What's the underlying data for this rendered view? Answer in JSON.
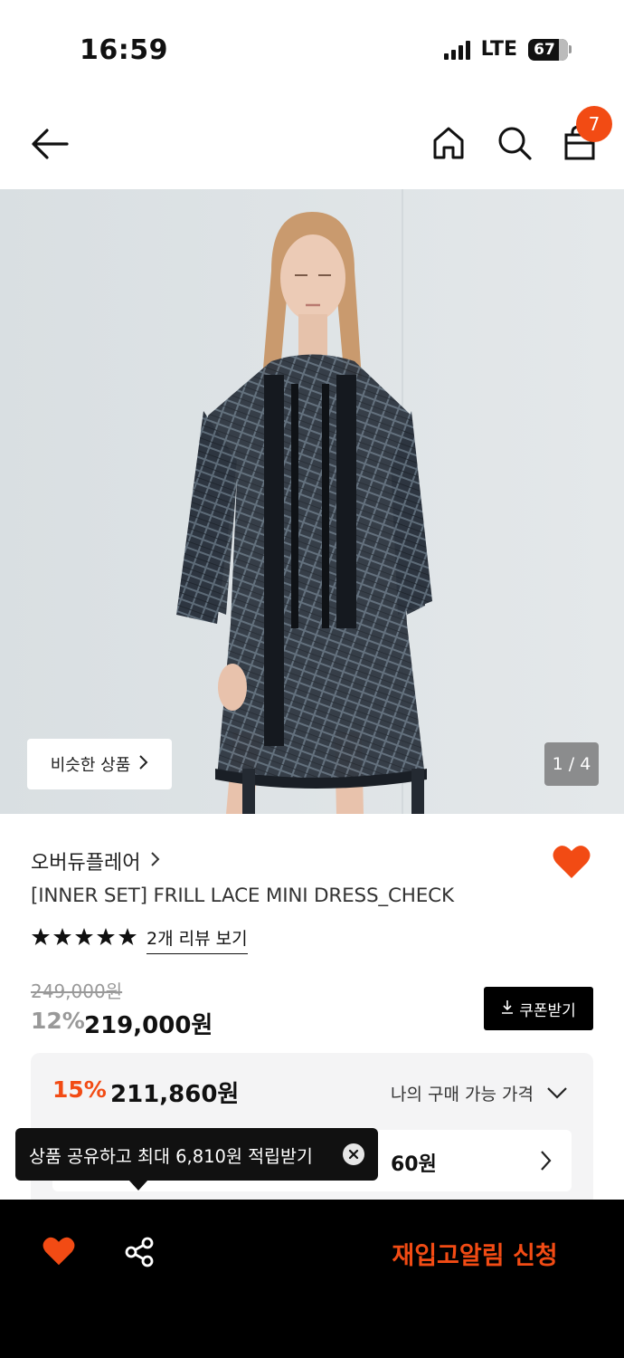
{
  "status_bar": {
    "time": "16:59",
    "network": "LTE",
    "battery": "67"
  },
  "nav": {
    "cart_count": "7"
  },
  "hero": {
    "similar_label": "비슷한 상품",
    "page_indicator": "1 / 4"
  },
  "product": {
    "brand": "오버듀플레어",
    "title": "[INNER SET] FRILL LACE MINI DRESS_CHECK",
    "rating_stars": 5,
    "review_link": "2개 리뷰 보기",
    "original_price": "249,000원",
    "discount_pct": "12%",
    "sale_price": "219,000원",
    "coupon_label": "쿠폰받기"
  },
  "best_price": {
    "pct": "15%",
    "price": "211,860원",
    "my_price_label": "나의 구매 가능 가격",
    "inner_price_partial": "60원"
  },
  "tooltip": {
    "text": "상품 공유하고 최대 6,810원 적립받기"
  },
  "bottom_bar": {
    "restock_label": "재입고알림 신청"
  },
  "colors": {
    "accent": "#f24b14",
    "black": "#000000",
    "box_bg": "#f4f4f5"
  },
  "icons": [
    "back-arrow-icon",
    "home-icon",
    "search-icon",
    "shopping-bag-icon",
    "heart-icon",
    "share-icon",
    "close-icon",
    "chevron-right-icon",
    "chevron-down-icon",
    "download-icon",
    "star-icon"
  ]
}
